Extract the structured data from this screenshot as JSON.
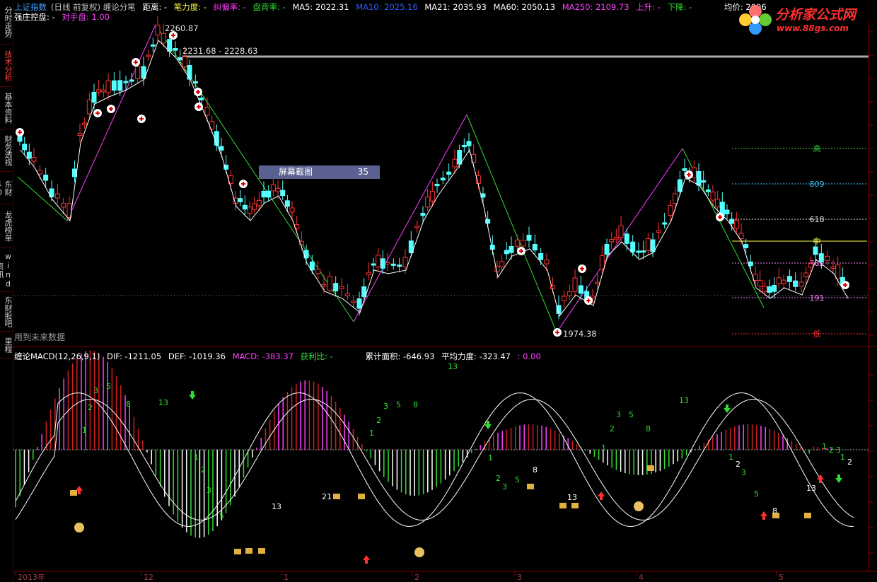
{
  "sidebar": {
    "tabs": [
      {
        "label": "分时走势",
        "active": false
      },
      {
        "label": "技术分析",
        "active": true
      },
      {
        "label": "基本资料",
        "active": false
      },
      {
        "label": "财务透视",
        "active": false
      },
      {
        "label": "东财10",
        "active": false
      },
      {
        "label": "龙虎榜单",
        "active": false
      },
      {
        "label": "wind资讯",
        "active": false
      },
      {
        "label": "东财股吧",
        "active": false
      },
      {
        "label": "里程",
        "active": false
      }
    ]
  },
  "legend": {
    "index_name": "上证指数",
    "index_mode": "(日线 前复权) 缠论分笔",
    "distance": "距离: -",
    "bi_strength": "笔力度: -",
    "deviation": "纠偏率: -",
    "divergence": "盘背率: -",
    "ma5": "MA5: 2022.31",
    "ma10": "MA10: 2025.16",
    "ma21": "MA21: 2035.93",
    "ma60": "MA60: 2050.13",
    "ma250": "MA250: 2109.73",
    "up": "上升: -",
    "down": "下降: -",
    "avg_price": "均价: 2006",
    "line2_a": "强庄控盘: -",
    "line2_b": "对手盘: 1.00"
  },
  "logo": {
    "title": "分析家公式网",
    "url": "www.88gs.com"
  },
  "screenshot_tag": {
    "label": "屏幕截图",
    "value": "35"
  },
  "future_data": "用到未来数据",
  "price_labels": {
    "high_peak": "2260.87",
    "range": "2231.68 - 2228.63",
    "low_trough": "1974.38"
  },
  "fib_levels": [
    {
      "label": "高",
      "color": "#30d030"
    },
    {
      "label": "809",
      "color": "#40c8ff"
    },
    {
      "label": "618",
      "color": "#e0e0e0"
    },
    {
      "label": "中",
      "color": "#ffff40"
    },
    {
      "label": "382",
      "color": "#ff80ff"
    },
    {
      "label": "191",
      "color": "#ff80ff"
    },
    {
      "label": "低",
      "color": "#ff3030"
    }
  ],
  "macd_legend": {
    "name": "缠论MACD(12,26,9,1)",
    "dif": "DIF: -1211.05",
    "def": "DEF: -1019.36",
    "macd": "MACD: -383.37",
    "profit": "获利比: -",
    "area": "累计面积: -646.93",
    "avg_force": "平均力度: -323.47",
    "extra": ": 0.00"
  },
  "date_labels": [
    "2013年",
    "12",
    "1",
    "2",
    "3",
    "4",
    "5"
  ],
  "colors": {
    "up": "#ff3232",
    "down": "#54ffff",
    "ma_white": "#ffffff",
    "bi_up": "#ff40ff",
    "bi_down": "#30e030",
    "grid": "#800000"
  }
}
